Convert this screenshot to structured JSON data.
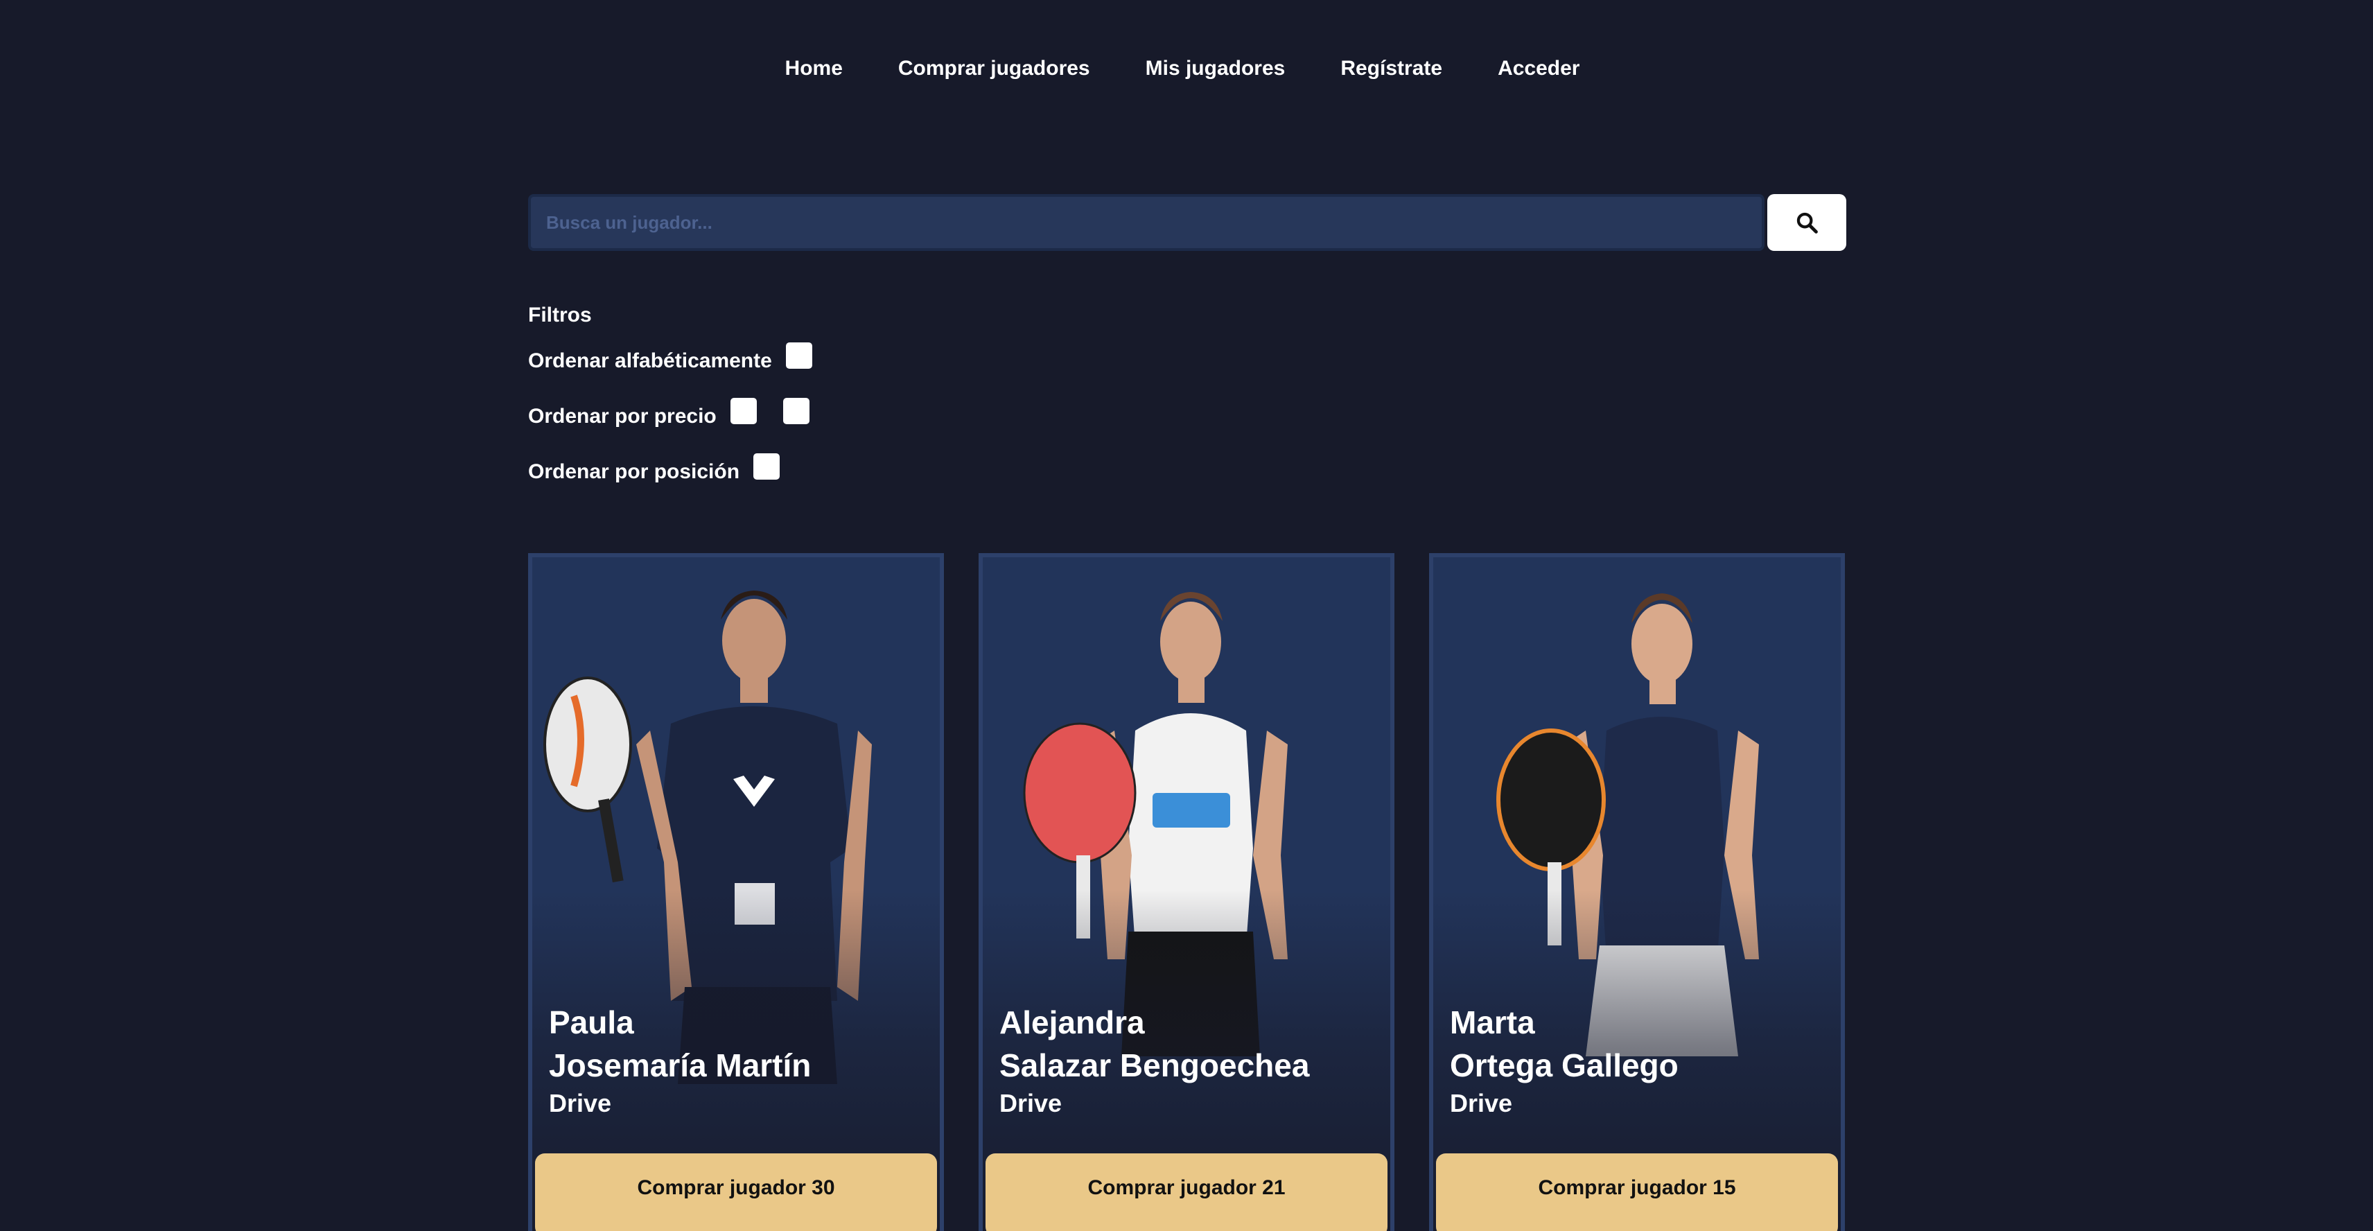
{
  "nav": {
    "home": "Home",
    "buy_players": "Comprar jugadores",
    "my_players": "Mis jugadores",
    "register": "Regístrate",
    "login": "Acceder"
  },
  "search": {
    "placeholder": "Busca un jugador...",
    "value": "",
    "button_icon": "search-icon"
  },
  "filters": {
    "title": "Filtros",
    "alphabetical": {
      "label": "Ordenar alfabéticamente",
      "checked": false
    },
    "price": {
      "label": "Ordenar por precio",
      "checked_1": false,
      "checked_2": false
    },
    "position": {
      "label": "Ordenar por posición",
      "checked": false
    }
  },
  "players": [
    {
      "first_name": "Paula",
      "last_name": "Josemaría Martín",
      "position": "Drive",
      "buy_label": "Comprar jugador 30",
      "photo": "player-photo"
    },
    {
      "first_name": "Alejandra",
      "last_name": "Salazar Bengoechea",
      "position": "Drive",
      "buy_label": "Comprar jugador 21",
      "photo": "player-photo"
    },
    {
      "first_name": "Marta",
      "last_name": "Ortega Gallego",
      "position": "Drive",
      "buy_label": "Comprar jugador 15",
      "photo": "player-photo"
    }
  ],
  "colors": {
    "background": "#171a2a",
    "card": "#22345a",
    "search_field": "#27375a",
    "buy_button": "#eac888"
  }
}
